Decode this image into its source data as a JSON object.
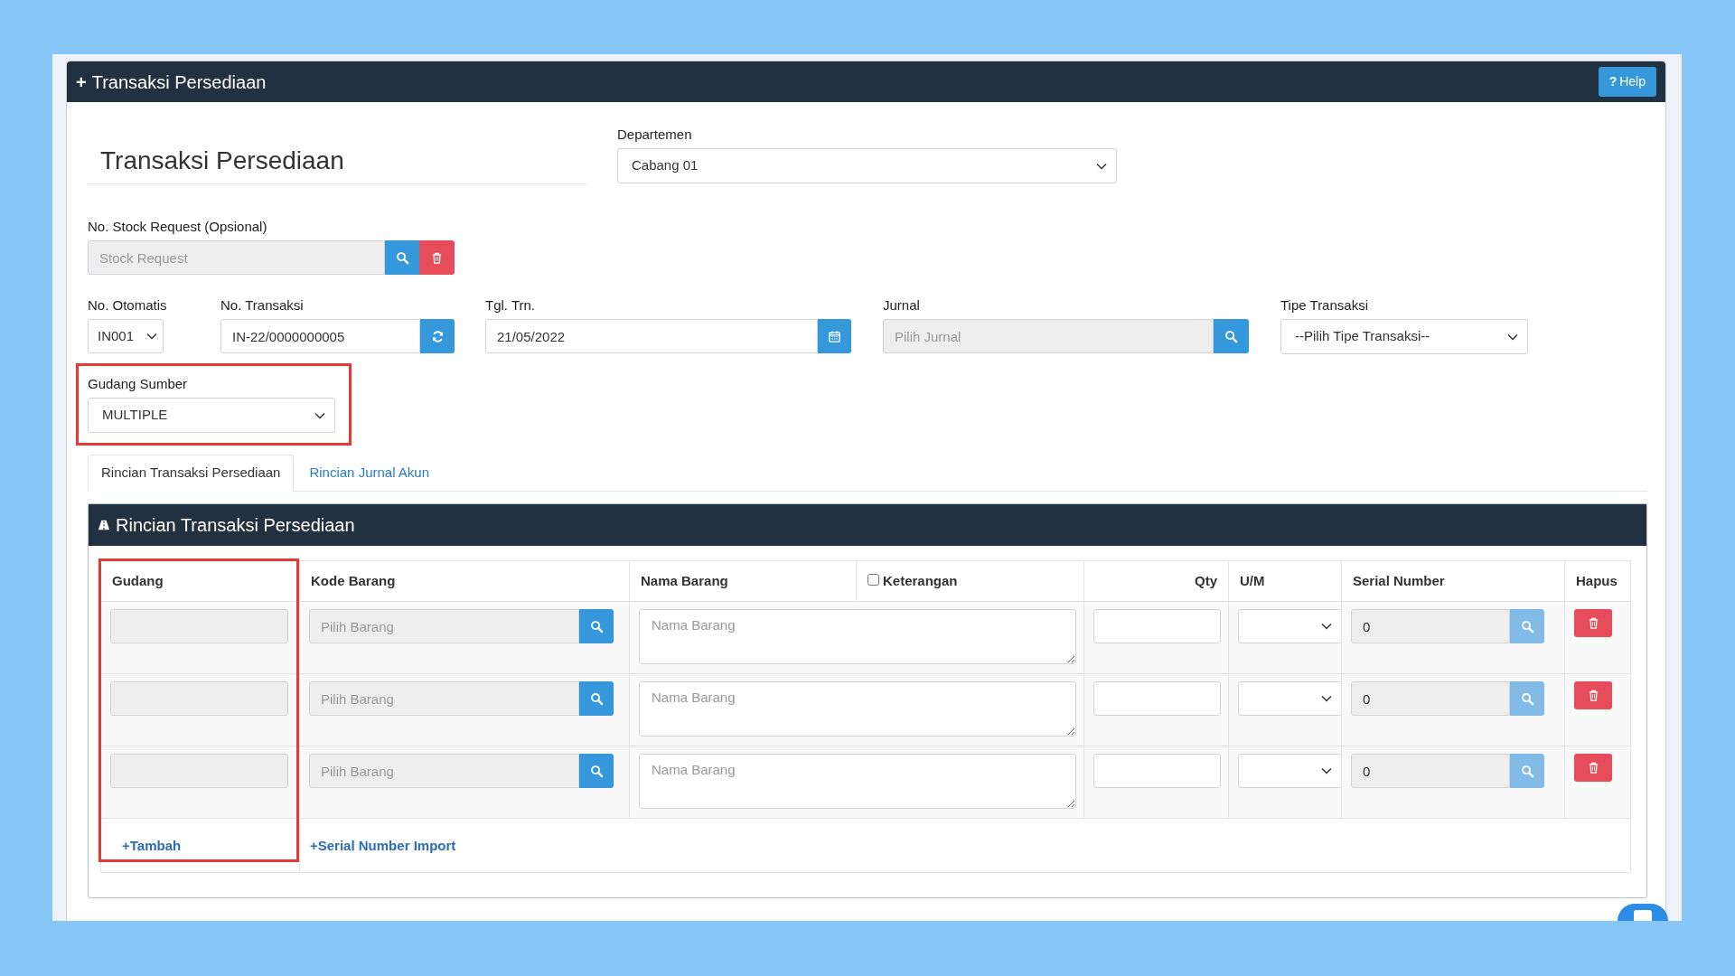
{
  "header": {
    "icon": "+",
    "title": "Transaksi Persediaan",
    "help": {
      "icon": "?",
      "label": "Help"
    }
  },
  "form": {
    "heading": "Transaksi Persediaan",
    "departemen": {
      "label": "Departemen",
      "value": "Cabang 01"
    },
    "stock_request": {
      "label": "No. Stock Request (Opsional)",
      "placeholder": "Stock Request"
    },
    "fields": [
      {
        "kind": "select",
        "label": "No. Otomatis",
        "value": "IN001"
      },
      {
        "kind": "refresh",
        "label": "No. Transaksi",
        "value": "IN-22/0000000005"
      },
      {
        "kind": "date",
        "label": "Tgl. Trn.",
        "value": "21/05/2022"
      },
      {
        "kind": "lookup",
        "label": "Jurnal",
        "placeholder": "Pilih Jurnal"
      },
      {
        "kind": "select",
        "label": "Tipe Transaksi",
        "value": "--Pilih Tipe Transaksi--"
      }
    ],
    "gudang_sumber": {
      "label": "Gudang Sumber",
      "value": "MULTIPLE",
      "highlighted": true
    }
  },
  "tabs": [
    {
      "label": "Rincian Transaksi Persediaan",
      "selected": true
    },
    {
      "label": "Rincian Jurnal Akun",
      "selected": false
    }
  ],
  "detail": {
    "title": "Rincian Transaksi Persediaan",
    "columns": [
      {
        "label": "Gudang",
        "kind": "text",
        "highlighted": true
      },
      {
        "label": "Kode Barang",
        "kind": "text"
      },
      {
        "label": "Nama Barang",
        "kind": "text"
      },
      {
        "label": "Keterangan",
        "kind": "checkbox",
        "checked": false
      },
      {
        "label": "Qty",
        "kind": "numeric"
      },
      {
        "label": "U/M",
        "kind": "text"
      },
      {
        "label": "Serial Number",
        "kind": "text"
      },
      {
        "label": "Hapus",
        "kind": "text"
      }
    ],
    "rows": [
      {
        "kode_placeholder": "Pilih Barang",
        "nama_placeholder": "Nama Barang",
        "serial": "0",
        "serial_lookup_disabled": true
      },
      {
        "kode_placeholder": "Pilih Barang",
        "nama_placeholder": "Nama Barang",
        "serial": "0",
        "serial_lookup_disabled": true
      },
      {
        "kode_placeholder": "Pilih Barang",
        "nama_placeholder": "Nama Barang",
        "serial": "0",
        "serial_lookup_disabled": true
      }
    ],
    "add_link": "+Tambah",
    "import_link": "+Serial Number Import"
  }
}
